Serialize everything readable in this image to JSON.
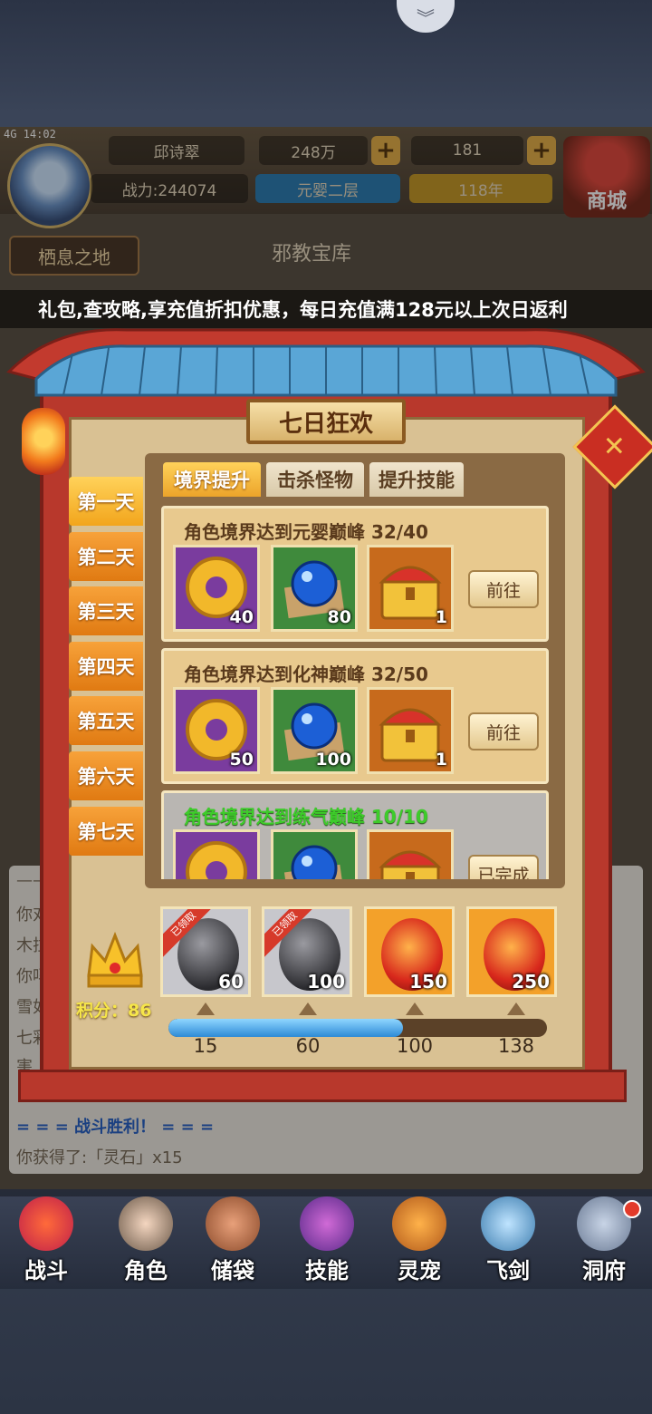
{
  "hud": {
    "status": "4G 14:02",
    "player_name": "邱诗翠",
    "power": "战力:244074",
    "jade": "248万",
    "gold": "181",
    "realm": "元婴二层",
    "age": "118年",
    "shop": "商城",
    "location": "栖息之地",
    "bg_title": "邪教宝库"
  },
  "marquee": "礼包,查攻略,享充值折扣优惠，每日充值满128元以上次日返利",
  "modal": {
    "title": "七日狂欢",
    "close_icon": "close-icon",
    "days": [
      "第一天",
      "第二天",
      "第三天",
      "第四天",
      "第五天",
      "第六天",
      "第七天"
    ],
    "active_day": 0,
    "categories": [
      "境界提升",
      "击杀怪物",
      "提升技能"
    ],
    "active_category": 0,
    "quests": [
      {
        "title": "角色境界达到元婴巅峰 32/40",
        "rewards": [
          {
            "icon": "jade-pendant-icon",
            "count": "40"
          },
          {
            "icon": "blue-orb-icon",
            "count": "80"
          },
          {
            "icon": "treasure-chest-icon",
            "count": "1"
          }
        ],
        "button": "前往"
      },
      {
        "title": "角色境界达到化神巅峰 32/50",
        "rewards": [
          {
            "icon": "jade-pendant-icon",
            "count": "50"
          },
          {
            "icon": "blue-orb-icon",
            "count": "100"
          },
          {
            "icon": "treasure-chest-icon",
            "count": "1"
          }
        ],
        "button": "前往"
      },
      {
        "title": "角色境界达到练气巅峰 10/10",
        "rewards": [
          {
            "icon": "jade-pendant-icon",
            "count": ""
          },
          {
            "icon": "blue-orb-icon",
            "count": ""
          },
          {
            "icon": "treasure-chest-icon",
            "count": ""
          }
        ],
        "button": "已完成"
      }
    ],
    "score_label": "积分：86",
    "score_progress": 0.62,
    "milestone_rewards": [
      {
        "count": "60",
        "claimed": true,
        "ribbon": "已领取"
      },
      {
        "count": "100",
        "claimed": true,
        "ribbon": "已领取"
      },
      {
        "count": "150",
        "claimed": false,
        "ribbon": ""
      },
      {
        "count": "250",
        "claimed": false,
        "ribbon": ""
      }
    ],
    "milestones": [
      "15",
      "60",
      "100",
      "138"
    ]
  },
  "log": {
    "dash": "——",
    "lines": [
      "你对",
      "木拉",
      "你吗",
      "雪如",
      "七彩",
      "害"
    ],
    "victory": "= = =  战斗胜利！  = = =",
    "obtained": "你获得了:「灵石」x15"
  },
  "nav": [
    "战斗",
    "角色",
    "储袋",
    "技能",
    "灵宠",
    "飞剑",
    "洞府"
  ],
  "colors": {
    "frame_red": "#b8382c",
    "gold": "#f2a51c",
    "done_green": "#3dcc2a"
  }
}
